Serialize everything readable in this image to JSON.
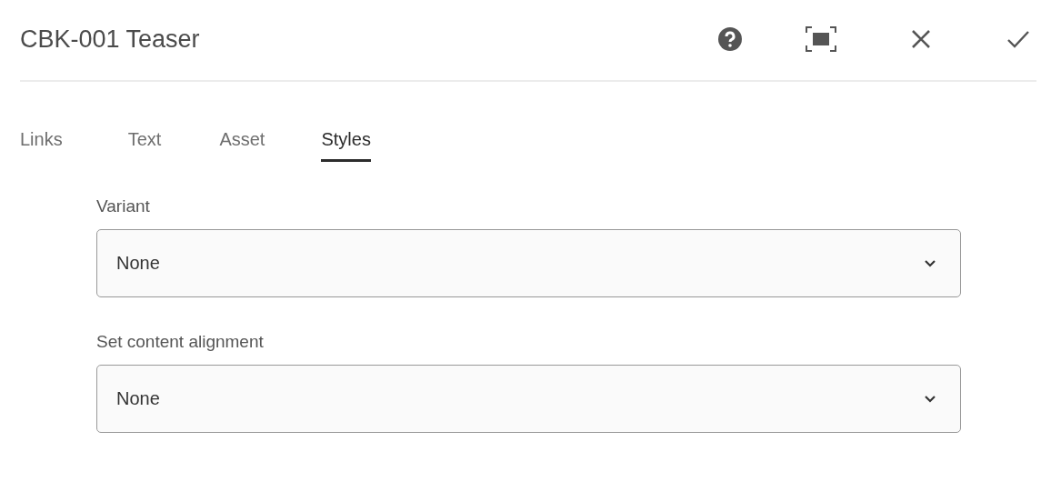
{
  "dialog": {
    "title": "CBK-001 Teaser"
  },
  "tabs": [
    {
      "label": "Links",
      "selected": false
    },
    {
      "label": "Text",
      "selected": false
    },
    {
      "label": "Asset",
      "selected": false
    },
    {
      "label": "Styles",
      "selected": true
    }
  ],
  "fields": [
    {
      "label": "Variant",
      "value": "None"
    },
    {
      "label": "Set content alignment",
      "value": "None"
    }
  ]
}
